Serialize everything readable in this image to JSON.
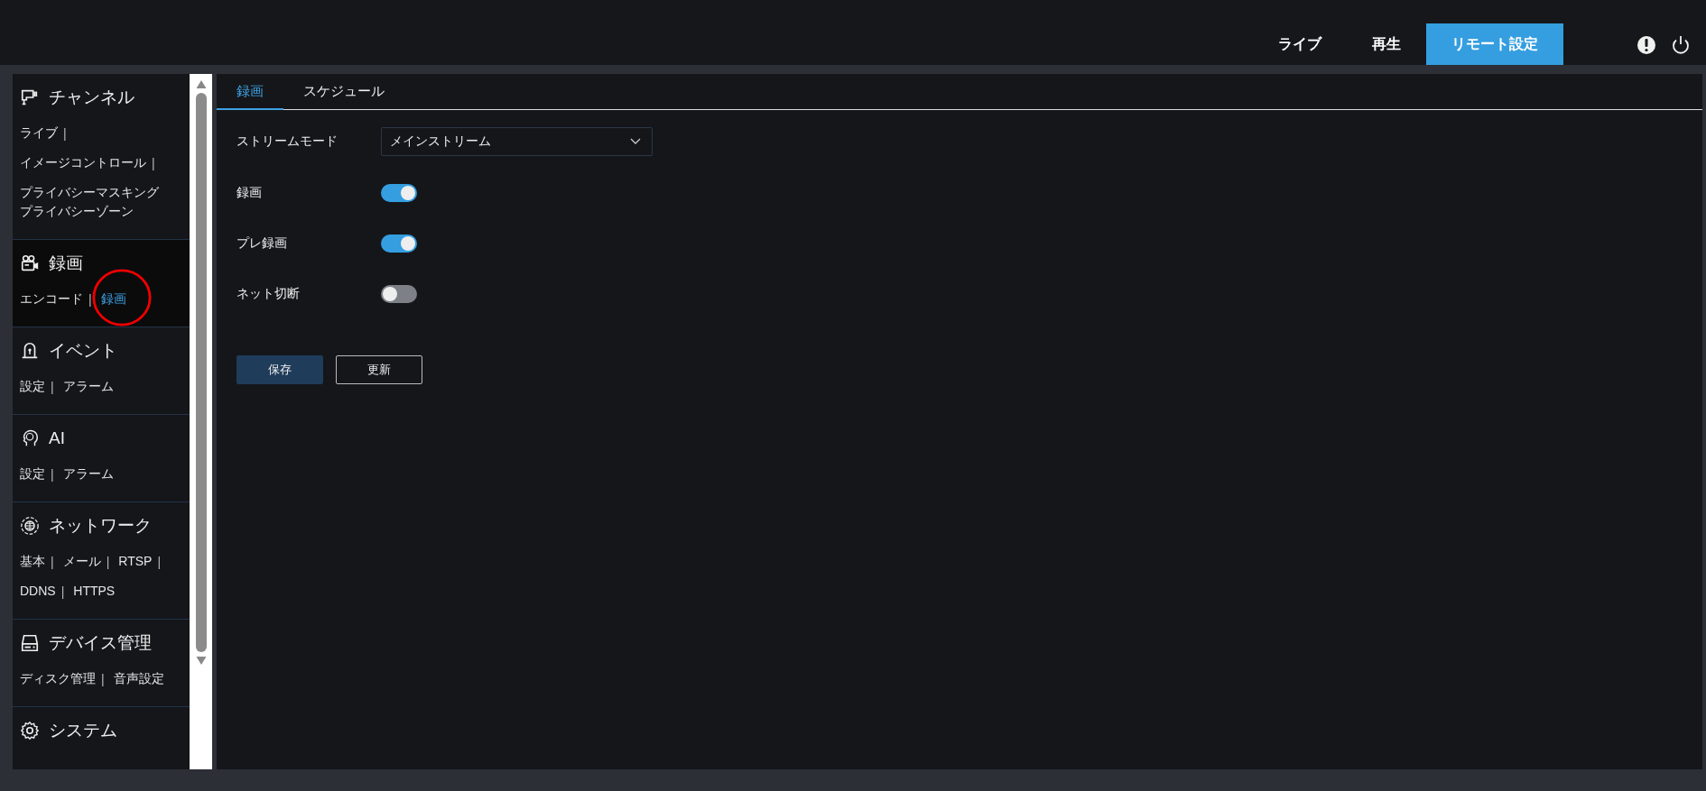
{
  "top_nav": [
    {
      "label": "ライブ",
      "selected": false
    },
    {
      "label": "再生",
      "selected": false
    },
    {
      "label": "リモート設定",
      "selected": true
    }
  ],
  "sidebar": [
    {
      "title": "チャンネル",
      "selected": false,
      "rows": [
        [
          {
            "label": "ライブ",
            "separator": "|",
            "selected": false
          }
        ],
        [
          {
            "label": "イメージコントロール",
            "separator": "|",
            "selected": false
          }
        ],
        [
          {
            "label": "プライバシーマスキング",
            "selected": false
          },
          {
            "label": "プライバシーゾーン",
            "selected": false
          }
        ]
      ]
    },
    {
      "title": "録画",
      "selected": true,
      "rows": [
        [
          {
            "label": "エンコード",
            "separator": "|",
            "selected": false
          },
          {
            "label": "録画",
            "selected": true
          }
        ]
      ]
    },
    {
      "title": "イベント",
      "selected": false,
      "rows": [
        [
          {
            "label": "設定",
            "separator": "|",
            "selected": false
          },
          {
            "label": "アラーム",
            "selected": false
          }
        ]
      ]
    },
    {
      "title": "AI",
      "selected": false,
      "rows": [
        [
          {
            "label": "設定",
            "separator": "|",
            "selected": false
          },
          {
            "label": "アラーム",
            "selected": false
          }
        ]
      ]
    },
    {
      "title": "ネットワーク",
      "selected": false,
      "rows": [
        [
          {
            "label": "基本",
            "separator": "|",
            "selected": false
          },
          {
            "label": "メール",
            "separator": "|",
            "selected": false
          },
          {
            "label": "RTSP",
            "separator": "|",
            "selected": false
          }
        ],
        [
          {
            "label": "DDNS",
            "separator": "|",
            "selected": false
          },
          {
            "label": "HTTPS",
            "selected": false
          }
        ]
      ]
    },
    {
      "title": "デバイス管理",
      "selected": false,
      "rows": [
        [
          {
            "label": "ディスク管理",
            "separator": "|",
            "selected": false
          },
          {
            "label": "音声設定",
            "selected": false
          }
        ]
      ]
    },
    {
      "title": "システム",
      "selected": false
    }
  ],
  "tabs": [
    {
      "label": "録画",
      "selected": true
    },
    {
      "label": "スケジュール",
      "selected": false
    }
  ],
  "fields": [
    {
      "kind": "select",
      "label": "ストリームモード",
      "value": "メインストリーム"
    },
    {
      "kind": "toggle",
      "label": "録画",
      "on": true
    },
    {
      "kind": "toggle",
      "label": "プレ録画",
      "on": true
    },
    {
      "kind": "toggle",
      "label": "ネット切断",
      "on": false
    }
  ],
  "buttons": [
    {
      "label": "保存",
      "kind": "primary"
    },
    {
      "label": "更新",
      "kind": "secondary"
    }
  ]
}
